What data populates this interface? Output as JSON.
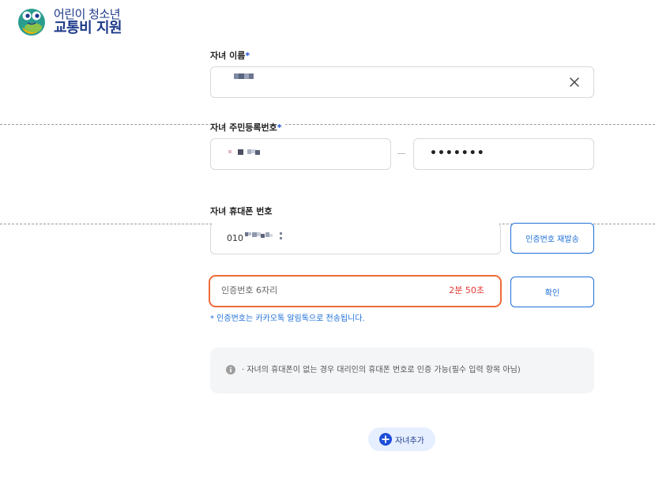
{
  "logo": {
    "line1": "어린이 청소년",
    "line2": "교통비 지원",
    "icon": "frog-mascot-icon"
  },
  "form": {
    "name": {
      "label": "자녀 이름",
      "required": "*",
      "clear_icon": "close-icon"
    },
    "resident_number": {
      "label": "자녀 주민등록번호",
      "required": "*",
      "separator": "–",
      "back_masked": "•••••••"
    },
    "phone": {
      "label": "자녀 휴대폰 번호",
      "prefix": "010",
      "resend_button": "인증번호 재발송"
    },
    "verification": {
      "placeholder": "인증번호 6자리",
      "timer": "2분 50초",
      "confirm_button": "확인",
      "notice": "* 인증번호는 카카오톡 알림톡으로 전송됩니다."
    },
    "info": {
      "icon": "info-icon",
      "text": "· 자녀의 휴대폰이 없는 경우 대리인의 휴대폰 번호로 인증 가능(필수 입력 항목 아님)"
    },
    "add_child": {
      "icon": "plus-circle-icon",
      "label": "자녀추가"
    }
  },
  "colors": {
    "primary": "#1d6fd8",
    "highlight_border": "#ef6b39",
    "timer": "#e53935",
    "info_bg": "#f4f5f7",
    "add_bg": "#e6efff"
  }
}
